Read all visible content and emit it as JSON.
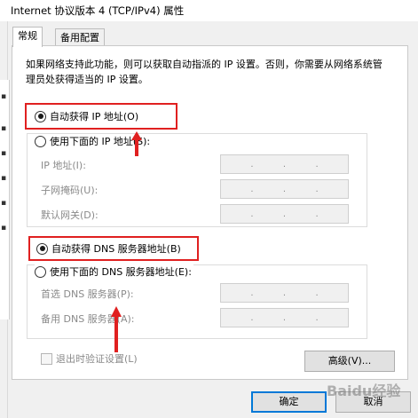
{
  "window": {
    "title": "Internet 协议版本 4 (TCP/IPv4) 属性"
  },
  "tabs": [
    {
      "label": "常规",
      "active": true
    },
    {
      "label": "备用配置",
      "active": false
    }
  ],
  "description": "如果网络支持此功能，则可以获取自动指派的 IP 设置。否则，你需要从网络系统管理员处获得适当的 IP 设置。",
  "ip_section": {
    "auto_option": {
      "label": "自动获得 IP 地址(O)",
      "selected": true
    },
    "manual_option": {
      "label": "使用下面的 IP 地址(S):",
      "selected": false
    },
    "fields": [
      {
        "label": "IP 地址(I):",
        "value": ". . ."
      },
      {
        "label": "子网掩码(U):",
        "value": ". . ."
      },
      {
        "label": "默认网关(D):",
        "value": ". . ."
      }
    ]
  },
  "dns_section": {
    "auto_option": {
      "label": "自动获得 DNS 服务器地址(B)",
      "selected": true
    },
    "manual_option": {
      "label": "使用下面的 DNS 服务器地址(E):",
      "selected": false
    },
    "fields": [
      {
        "label": "首选 DNS 服务器(P):",
        "value": ". . ."
      },
      {
        "label": "备用 DNS 服务器(A):",
        "value": ". . ."
      }
    ]
  },
  "validate_checkbox": {
    "label": "退出时验证设置(L)",
    "checked": false
  },
  "buttons": {
    "advanced": "高级(V)...",
    "ok": "确定",
    "cancel": "取消"
  },
  "watermark": "Baidu经验",
  "annotation_color": "#e02020",
  "accent_color": "#0078d7"
}
